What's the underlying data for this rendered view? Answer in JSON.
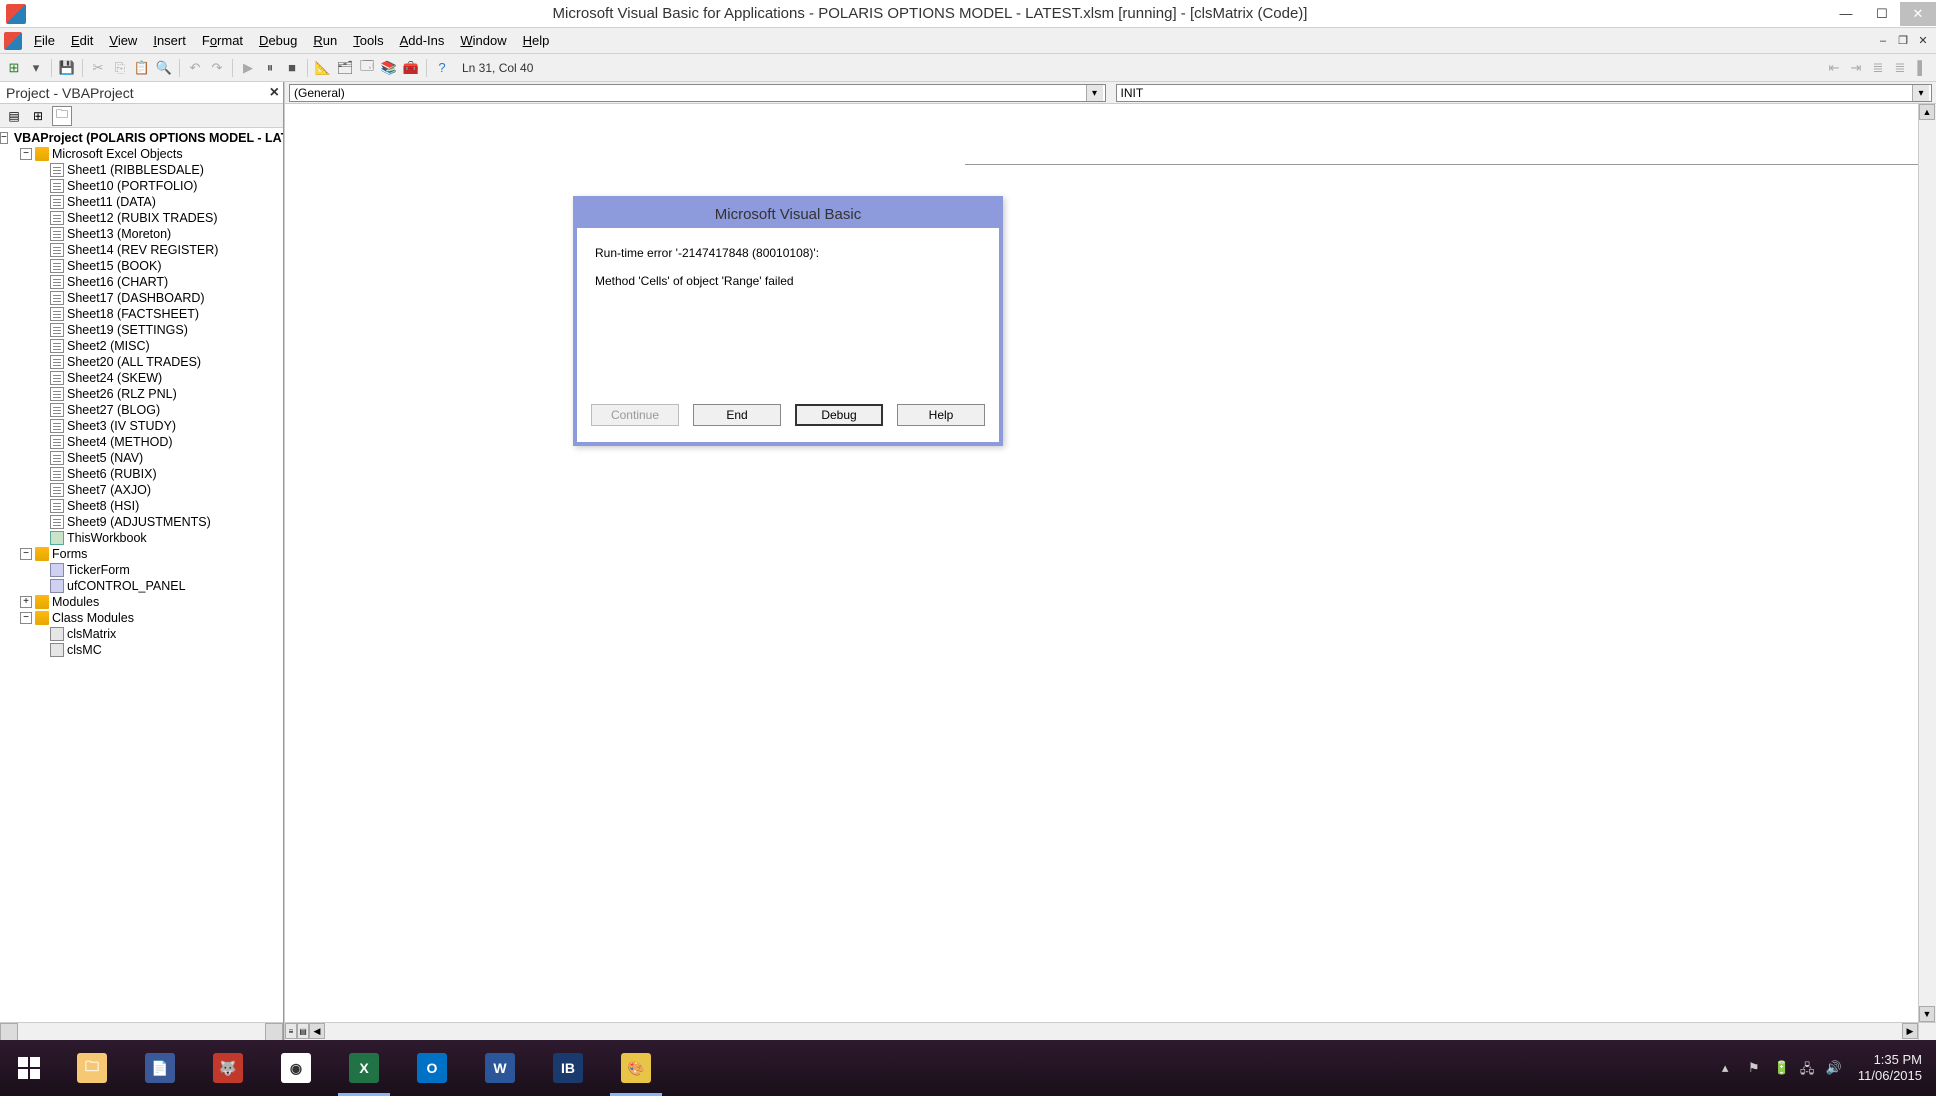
{
  "window": {
    "title": "Microsoft Visual Basic for Applications - POLARIS OPTIONS MODEL  - LATEST.xlsm [running] - [clsMatrix (Code)]"
  },
  "menu": {
    "file": "File",
    "edit": "Edit",
    "view": "View",
    "insert": "Insert",
    "format": "Format",
    "debug": "Debug",
    "run": "Run",
    "tools": "Tools",
    "addins": "Add-Ins",
    "window": "Window",
    "help": "Help"
  },
  "toolbar": {
    "status": "Ln 31, Col 40"
  },
  "projectPane": {
    "title": "Project - VBAProject",
    "root": "VBAProject (POLARIS OPTIONS MODEL  - LATEST.xlsm)",
    "folders": {
      "excelObjects": "Microsoft Excel Objects",
      "forms": "Forms",
      "modules": "Modules",
      "classModules": "Class Modules"
    },
    "sheets": [
      "Sheet1 (RIBBLESDALE)",
      "Sheet10 (PORTFOLIO)",
      "Sheet11 (DATA)",
      "Sheet12 (RUBIX TRADES)",
      "Sheet13 (Moreton)",
      "Sheet14 (REV REGISTER)",
      "Sheet15 (BOOK)",
      "Sheet16 (CHART)",
      "Sheet17 (DASHBOARD)",
      "Sheet18 (FACTSHEET)",
      "Sheet19 (SETTINGS)",
      "Sheet2 (MISC)",
      "Sheet20 (ALL TRADES)",
      "Sheet24 (SKEW)",
      "Sheet26 (RLZ PNL)",
      "Sheet27 (BLOG)",
      "Sheet3 (IV STUDY)",
      "Sheet4 (METHOD)",
      "Sheet5 (NAV)",
      "Sheet6 (RUBIX)",
      "Sheet7 (AXJO)",
      "Sheet8 (HSI)",
      "Sheet9 (ADJUSTMENTS)"
    ],
    "thisWorkbook": "ThisWorkbook",
    "formsItems": [
      "TickerForm",
      "ufCONTROL_PANEL"
    ],
    "classItems": [
      "clsMatrix",
      "clsMC"
    ]
  },
  "codePane": {
    "leftDropdown": "(General)",
    "rightDropdown": "INIT"
  },
  "dialog": {
    "title": "Microsoft Visual Basic",
    "line1": "Run-time error '-2147417848 (80010108)':",
    "line2": "Method 'Cells' of object 'Range' failed",
    "buttons": {
      "continue": "Continue",
      "end": "End",
      "debug": "Debug",
      "help": "Help"
    }
  },
  "taskbar": {
    "time": "1:35 PM",
    "date": "11/06/2015"
  }
}
